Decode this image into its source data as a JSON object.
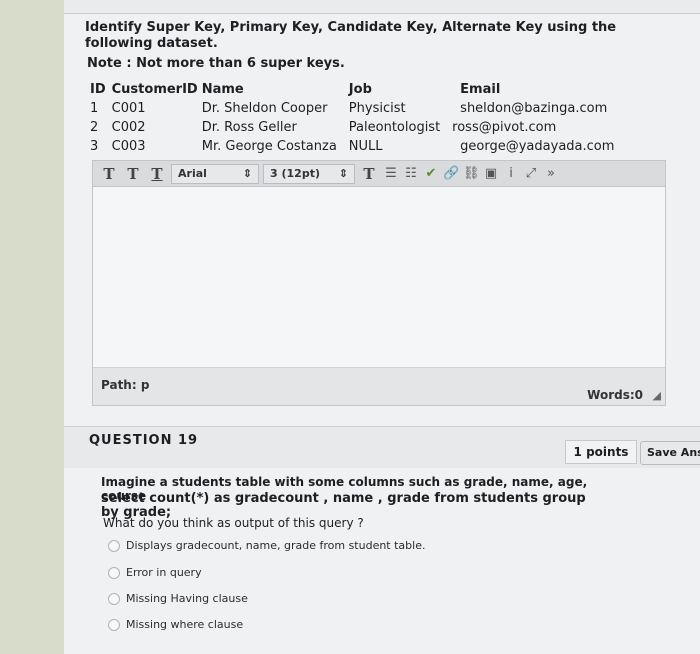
{
  "question_prev": {
    "text": "Identify Super Key, Primary Key, Candidate Key, Alternate Key using the following dataset.",
    "note": "Note : Not more than 6 super keys.",
    "table": {
      "headers": [
        "ID",
        "CustomerID",
        "Name",
        "Job",
        "Email"
      ],
      "rows": [
        [
          "1",
          "C001",
          "Dr. Sheldon Cooper",
          "Physicist",
          "sheldon@bazinga.com"
        ],
        [
          "2",
          "C002",
          "Dr. Ross Geller",
          "Paleontologist",
          "ross@pivot.com"
        ],
        [
          "3",
          "C003",
          "Mr. George Costanza",
          "NULL",
          "george@yadayada.com"
        ]
      ]
    }
  },
  "editor": {
    "font_family": "Arial",
    "font_size": "3 (12pt)",
    "path_label": "Path: p",
    "words_label": "Words:0"
  },
  "question19": {
    "title": "QUESTION 19",
    "points": "1 points",
    "save_label": "Save Ans",
    "prompt_line1": "Imagine a students table with some columns such as grade, name, age, course",
    "prompt_query": "select count(*) as gradecount , name , grade from students group by grade;",
    "prompt_question": "What do you think as output of this query ?",
    "options": [
      "Displays gradecount, name, grade from student table.",
      "Error in query",
      "Missing Having clause",
      "Missing where clause"
    ]
  }
}
